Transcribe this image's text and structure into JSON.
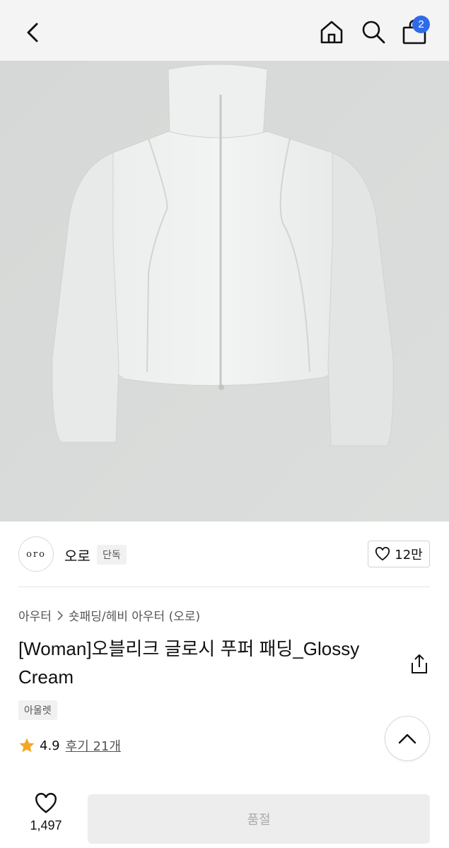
{
  "header": {
    "back_icon": "chevron-left-icon",
    "home_icon": "home-icon",
    "search_icon": "search-icon",
    "cart_icon": "shopping-bag-icon",
    "cart_count": "2",
    "badge_color": "#2f6be8"
  },
  "brand": {
    "logo_text": "oro",
    "name": "오로",
    "tag": "단독",
    "like_count": "12만"
  },
  "product": {
    "breadcrumb": [
      "아우터",
      "숏패딩/헤비 아우터 (오로)"
    ],
    "title": "[Woman]오블리크 글로시 푸퍼 패딩_Glossy Cream",
    "outlet_tag": "아울렛",
    "rating": "4.9",
    "reviews": "후기 21개",
    "star_color": "#f5a623"
  },
  "bottom": {
    "wish_count": "1,497",
    "buy_button": "품절"
  }
}
